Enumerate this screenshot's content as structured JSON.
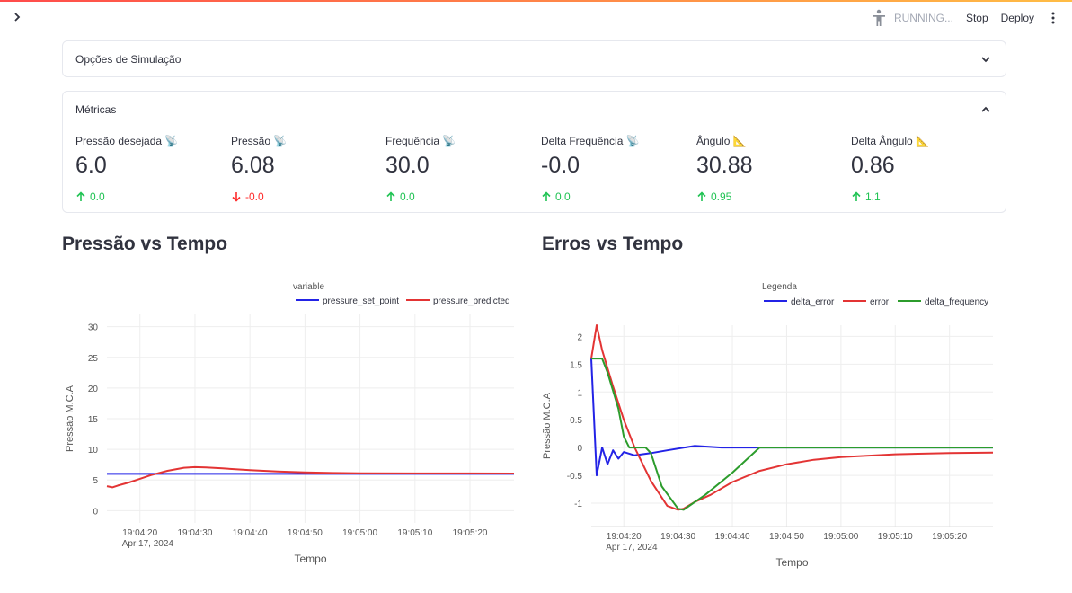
{
  "toolbar": {
    "status": "RUNNING...",
    "stop_label": "Stop",
    "deploy_label": "Deploy"
  },
  "simulation_options": {
    "title": "Opções de Simulação"
  },
  "metrics": {
    "title": "Métricas",
    "items": [
      {
        "label": "Pressão desejada 📡",
        "value": "6.0",
        "delta": "0.0",
        "direction": "up"
      },
      {
        "label": "Pressão 📡",
        "value": "6.08",
        "delta": "-0.0",
        "direction": "down"
      },
      {
        "label": "Frequência 📡",
        "value": "30.0",
        "delta": "0.0",
        "direction": "up"
      },
      {
        "label": "Delta Frequência 📡",
        "value": "-0.0",
        "delta": "0.0",
        "direction": "up"
      },
      {
        "label": "Ângulo 📐",
        "value": "30.88",
        "delta": "0.95",
        "direction": "up"
      },
      {
        "label": "Delta Ângulo 📐",
        "value": "0.86",
        "delta": "1.1",
        "direction": "up"
      }
    ]
  },
  "colors": {
    "up": "#21c354",
    "down": "#ff2b2b",
    "blue": "#2323e6",
    "red": "#e33434",
    "green": "#2c9c2c"
  },
  "pressure_chart": {
    "title": "Pressão vs Tempo",
    "date_label": "Apr 17, 2024"
  },
  "errors_chart": {
    "title": "Erros vs Tempo",
    "date_label": "Apr 17, 2024"
  },
  "chart_data": [
    {
      "type": "line",
      "title": "Pressão vs Tempo",
      "xlabel": "Tempo",
      "ylabel": "Pressão M.C.A",
      "legend_title": "variable",
      "legend_position": "top-right",
      "xlim": [
        "19:04:14",
        "19:05:28"
      ],
      "ylim": [
        -2,
        32
      ],
      "x_ticks": [
        "19:04:20",
        "19:04:30",
        "19:04:40",
        "19:04:50",
        "19:05:00",
        "19:05:10",
        "19:05:20"
      ],
      "y_ticks": [
        0,
        5,
        10,
        15,
        20,
        25,
        30
      ],
      "series": [
        {
          "name": "pressure_set_point",
          "color": "#2323e6",
          "x": [
            "19:04:14",
            "19:05:28"
          ],
          "y": [
            6.0,
            6.0
          ]
        },
        {
          "name": "pressure_predicted",
          "color": "#e33434",
          "x": [
            "19:04:14",
            "19:04:15",
            "19:04:16",
            "19:04:18",
            "19:04:20",
            "19:04:22",
            "19:04:25",
            "19:04:28",
            "19:04:30",
            "19:04:32",
            "19:04:35",
            "19:04:40",
            "19:04:45",
            "19:04:50",
            "19:04:55",
            "19:05:00",
            "19:05:10",
            "19:05:20",
            "19:05:28"
          ],
          "y": [
            4.0,
            3.8,
            4.1,
            4.6,
            5.2,
            5.8,
            6.5,
            7.0,
            7.1,
            7.05,
            6.9,
            6.6,
            6.4,
            6.25,
            6.15,
            6.1,
            6.08,
            6.07,
            6.06
          ]
        }
      ]
    },
    {
      "type": "line",
      "title": "Erros vs Tempo",
      "xlabel": "Tempo",
      "ylabel": "Pressão M.C.A",
      "legend_title": "Legenda",
      "legend_position": "top-right",
      "xlim": [
        "19:04:14",
        "19:05:28"
      ],
      "ylim": [
        -1.42,
        2.2
      ],
      "x_ticks": [
        "19:04:20",
        "19:04:30",
        "19:04:40",
        "19:04:50",
        "19:05:00",
        "19:05:10",
        "19:05:20"
      ],
      "y_ticks": [
        -1,
        -0.5,
        0,
        0.5,
        1,
        1.5,
        2
      ],
      "series": [
        {
          "name": "delta_error",
          "color": "#2323e6",
          "x": [
            "19:04:14",
            "19:04:15",
            "19:04:16",
            "19:04:17",
            "19:04:18",
            "19:04:19",
            "19:04:20",
            "19:04:22",
            "19:04:25",
            "19:04:28",
            "19:04:33",
            "19:04:38",
            "19:04:45",
            "19:05:00",
            "19:05:28"
          ],
          "y": [
            1.6,
            -0.5,
            0.0,
            -0.3,
            -0.05,
            -0.2,
            -0.08,
            -0.14,
            -0.1,
            -0.05,
            0.03,
            0.0,
            0.0,
            0.0,
            0.0
          ]
        },
        {
          "name": "error",
          "color": "#e33434",
          "x": [
            "19:04:14",
            "19:04:15",
            "19:04:16",
            "19:04:18",
            "19:04:20",
            "19:04:22",
            "19:04:25",
            "19:04:28",
            "19:04:30",
            "19:04:31",
            "19:04:33",
            "19:04:36",
            "19:04:40",
            "19:04:45",
            "19:04:50",
            "19:04:55",
            "19:05:00",
            "19:05:10",
            "19:05:20",
            "19:05:28"
          ],
          "y": [
            1.6,
            2.2,
            1.75,
            1.1,
            0.5,
            0.0,
            -0.6,
            -1.05,
            -1.12,
            -1.1,
            -0.98,
            -0.85,
            -0.62,
            -0.42,
            -0.3,
            -0.22,
            -0.17,
            -0.12,
            -0.1,
            -0.09
          ]
        },
        {
          "name": "delta_frequency",
          "color": "#2c9c2c",
          "x": [
            "19:04:14",
            "19:04:16",
            "19:04:17",
            "19:04:19",
            "19:04:20",
            "19:04:21",
            "19:04:24",
            "19:04:25",
            "19:04:27",
            "19:04:30",
            "19:04:31",
            "19:04:35",
            "19:04:40",
            "19:04:45",
            "19:05:28"
          ],
          "y": [
            1.6,
            1.6,
            1.35,
            0.7,
            0.2,
            0.0,
            0.0,
            -0.1,
            -0.7,
            -1.1,
            -1.12,
            -0.85,
            -0.45,
            0.0,
            0.0
          ]
        }
      ]
    }
  ]
}
